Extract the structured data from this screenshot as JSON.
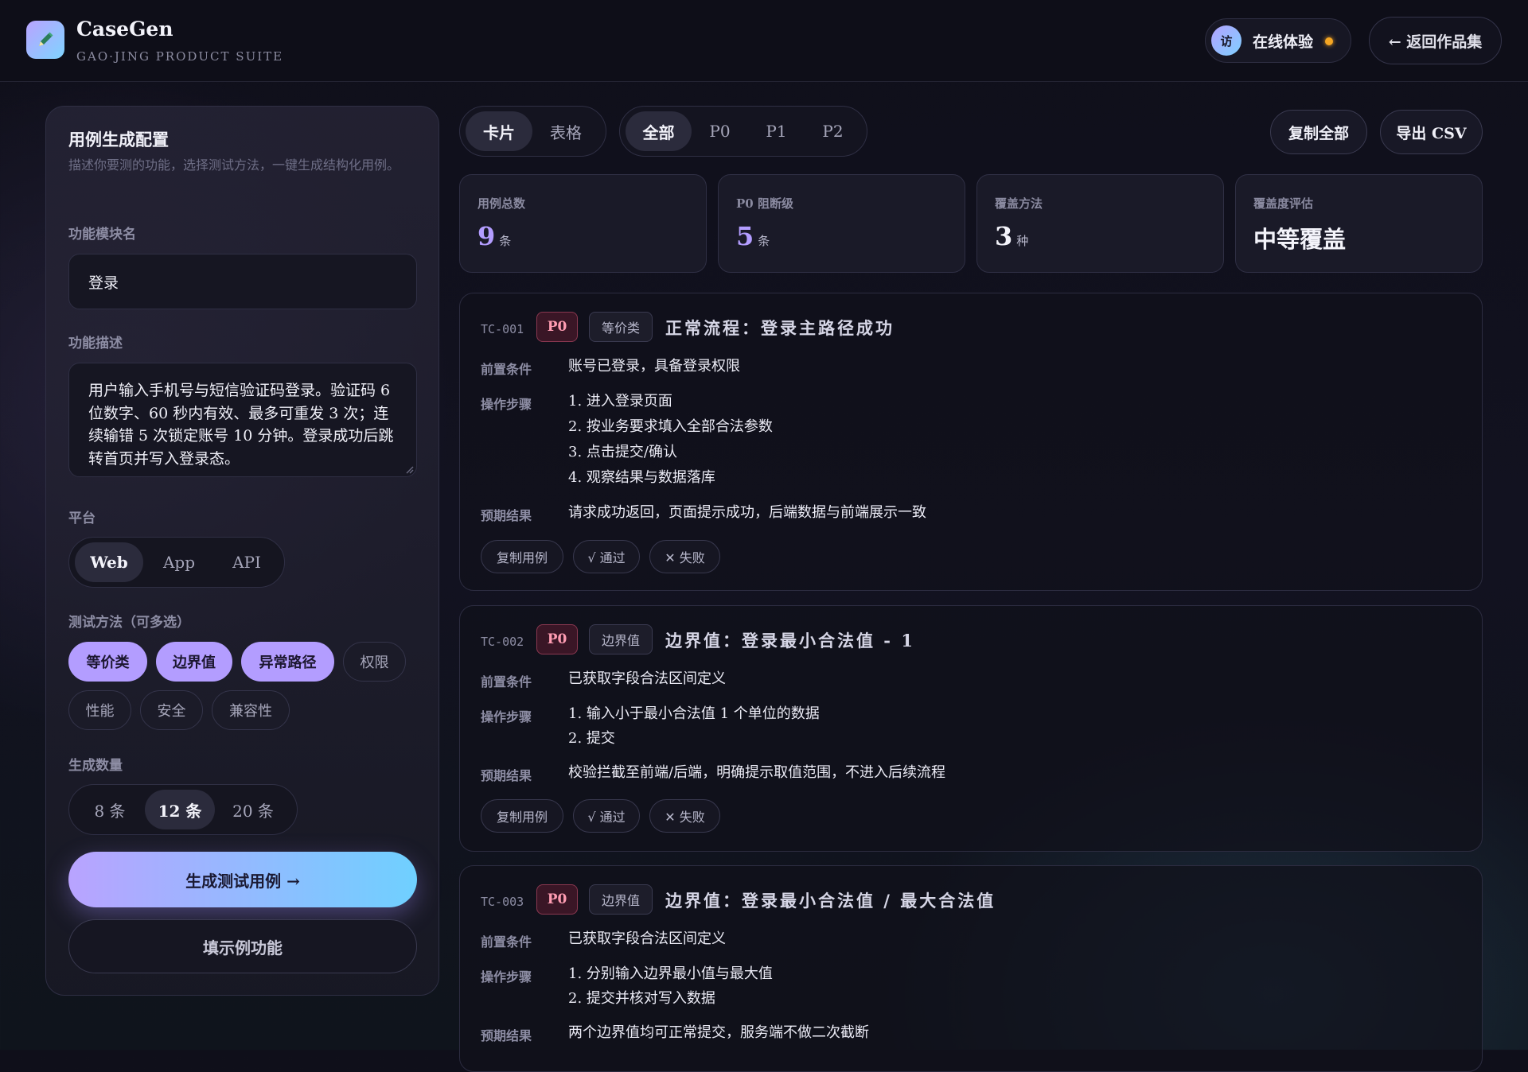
{
  "header": {
    "app_name": "CaseGen",
    "suite_name": "GAO·JING PRODUCT SUITE",
    "visitor_avatar": "访",
    "online_label": "在线体验",
    "back_label": "← 返回作品集",
    "colors": {
      "accent_start": "#b9a3ff",
      "accent_end": "#6fd0ff",
      "status_dot": "#f5a623"
    }
  },
  "config": {
    "title": "用例生成配置",
    "description": "描述你要测的功能，选择测试方法，一键生成结构化用例。",
    "module_label": "功能模块名",
    "module_value": "登录",
    "desc_label": "功能描述",
    "desc_value": "用户输入手机号与短信验证码登录。验证码 6 位数字、60 秒内有效、最多可重发 3 次；连续输错 5 次锁定账号 10 分钟。登录成功后跳转首页并写入登录态。",
    "platform_label": "平台",
    "platforms": [
      "Web",
      "App",
      "API"
    ],
    "platform_selected": "Web",
    "methods_label": "测试方法（可多选）",
    "methods": [
      "等价类",
      "边界值",
      "异常路径",
      "权限",
      "性能",
      "安全",
      "兼容性"
    ],
    "methods_selected": [
      "等价类",
      "边界值",
      "异常路径"
    ],
    "count_label": "生成数量",
    "counts": [
      "8 条",
      "12 条",
      "20 条"
    ],
    "count_selected": "12 条",
    "generate_label": "生成测试用例 →",
    "fill_example_label": "填示例功能"
  },
  "toolbar": {
    "views": [
      "卡片",
      "表格"
    ],
    "view_selected": "卡片",
    "filters": [
      "全部",
      "P0",
      "P1",
      "P2"
    ],
    "filter_selected": "全部",
    "copy_all_label": "复制全部",
    "export_label": "导出 CSV"
  },
  "stats": [
    {
      "label": "用例总数",
      "value": "9",
      "unit": "条",
      "color": "#b39dff"
    },
    {
      "label": "P0 阻断级",
      "value": "5",
      "unit": "条",
      "color": "#b39dff"
    },
    {
      "label": "覆盖方法",
      "value": "3",
      "unit": "种",
      "color": "#f3f3fa"
    },
    {
      "label": "覆盖度评估",
      "value": "中等覆盖",
      "unit": "",
      "color": "#f3f3fa"
    }
  ],
  "row_labels": {
    "precondition": "前置条件",
    "steps": "操作步骤",
    "expected": "预期结果"
  },
  "case_actions": {
    "copy": "复制用例",
    "pass": "√ 通过",
    "fail": "✕ 失败"
  },
  "cases": [
    {
      "id": "TC-001",
      "priority": "P0",
      "type": "等价类",
      "title": "正常流程：登录主路径成功",
      "precondition": "账号已登录，具备登录权限",
      "steps": [
        "1. 进入登录页面",
        "2. 按业务要求填入全部合法参数",
        "3. 点击提交/确认",
        "4. 观察结果与数据落库"
      ],
      "expected": "请求成功返回，页面提示成功，后端数据与前端展示一致"
    },
    {
      "id": "TC-002",
      "priority": "P0",
      "type": "边界值",
      "title": "边界值：登录最小合法值 - 1",
      "precondition": "已获取字段合法区间定义",
      "steps": [
        "1. 输入小于最小合法值 1 个单位的数据",
        "2. 提交"
      ],
      "expected": "校验拦截至前端/后端，明确提示取值范围，不进入后续流程"
    },
    {
      "id": "TC-003",
      "priority": "P0",
      "type": "边界值",
      "title": "边界值：登录最小合法值 / 最大合法值",
      "precondition": "已获取字段合法区间定义",
      "steps": [
        "1. 分别输入边界最小值与最大值",
        "2. 提交并核对写入数据"
      ],
      "expected": "两个边界值均可正常提交，服务端不做二次截断"
    }
  ]
}
